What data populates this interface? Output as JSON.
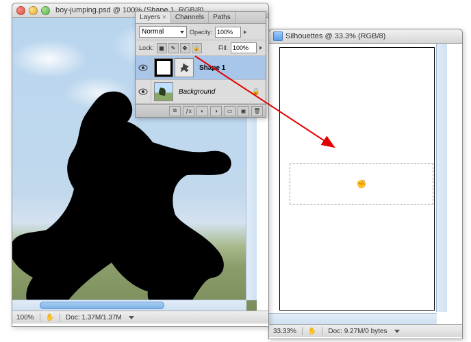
{
  "win1": {
    "title": "boy-jumping.psd @ 100% (Shape 1, RGB/8)",
    "zoom": "100%",
    "doc_size": "Doc: 1.37M/1.37M"
  },
  "win2": {
    "title": "Silhouettes @ 33.3% (RGB/8)",
    "zoom": "33.33%",
    "doc_size": "Doc: 9.27M/0 bytes"
  },
  "panel": {
    "tabs": {
      "layers": "Layers",
      "channels": "Channels",
      "paths": "Paths"
    },
    "blend_mode": "Normal",
    "opacity_label": "Opacity:",
    "opacity_value": "100%",
    "lock_label": "Lock:",
    "fill_label": "Fill:",
    "fill_value": "100%",
    "shape_layer": "Shape 1",
    "background_layer": "Background"
  }
}
